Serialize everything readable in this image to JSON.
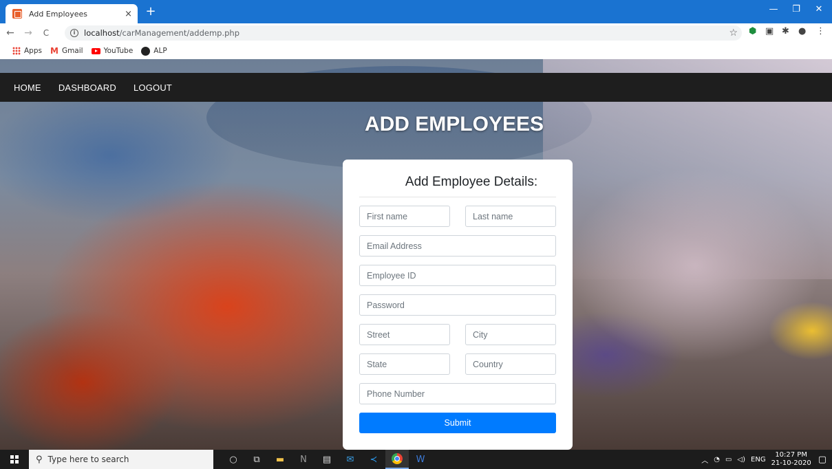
{
  "browser": {
    "tab_title": "Add Employees",
    "tab_close": "×",
    "new_tab": "+",
    "window_controls": {
      "minimize": "—",
      "restore": "❐",
      "close": "✕"
    },
    "nav": {
      "back": "←",
      "forward": "→",
      "reload": "C"
    },
    "url_host": "localhost",
    "url_path": "/carManagement/addemp.php",
    "bookmarks": [
      {
        "label": "Apps",
        "icon": "apps-grid-icon"
      },
      {
        "label": "Gmail",
        "icon": "gmail-icon"
      },
      {
        "label": "YouTube",
        "icon": "youtube-icon"
      },
      {
        "label": "ALP",
        "icon": "github-icon"
      }
    ]
  },
  "page": {
    "nav_links": [
      "HOME",
      "DASHBOARD",
      "LOGOUT"
    ],
    "heading": "ADD EMPLOYEES",
    "form": {
      "title": "Add Employee Details:",
      "placeholders": {
        "first_name": "First name",
        "last_name": "Last name",
        "email": "Email Address",
        "employee_id": "Employee ID",
        "password": "Password",
        "street": "Street",
        "city": "City",
        "state": "State",
        "country": "Country",
        "phone": "Phone Number"
      },
      "submit_label": "Submit"
    }
  },
  "taskbar": {
    "search_placeholder": "Type here to search",
    "language": "ENG",
    "time": "10:27 PM",
    "date": "21-10-2020"
  },
  "colors": {
    "chrome_blue": "#1a73d1",
    "navbar": "#1e1e1e",
    "submit_button": "#007bff",
    "taskbar": "#1c1c1c"
  }
}
